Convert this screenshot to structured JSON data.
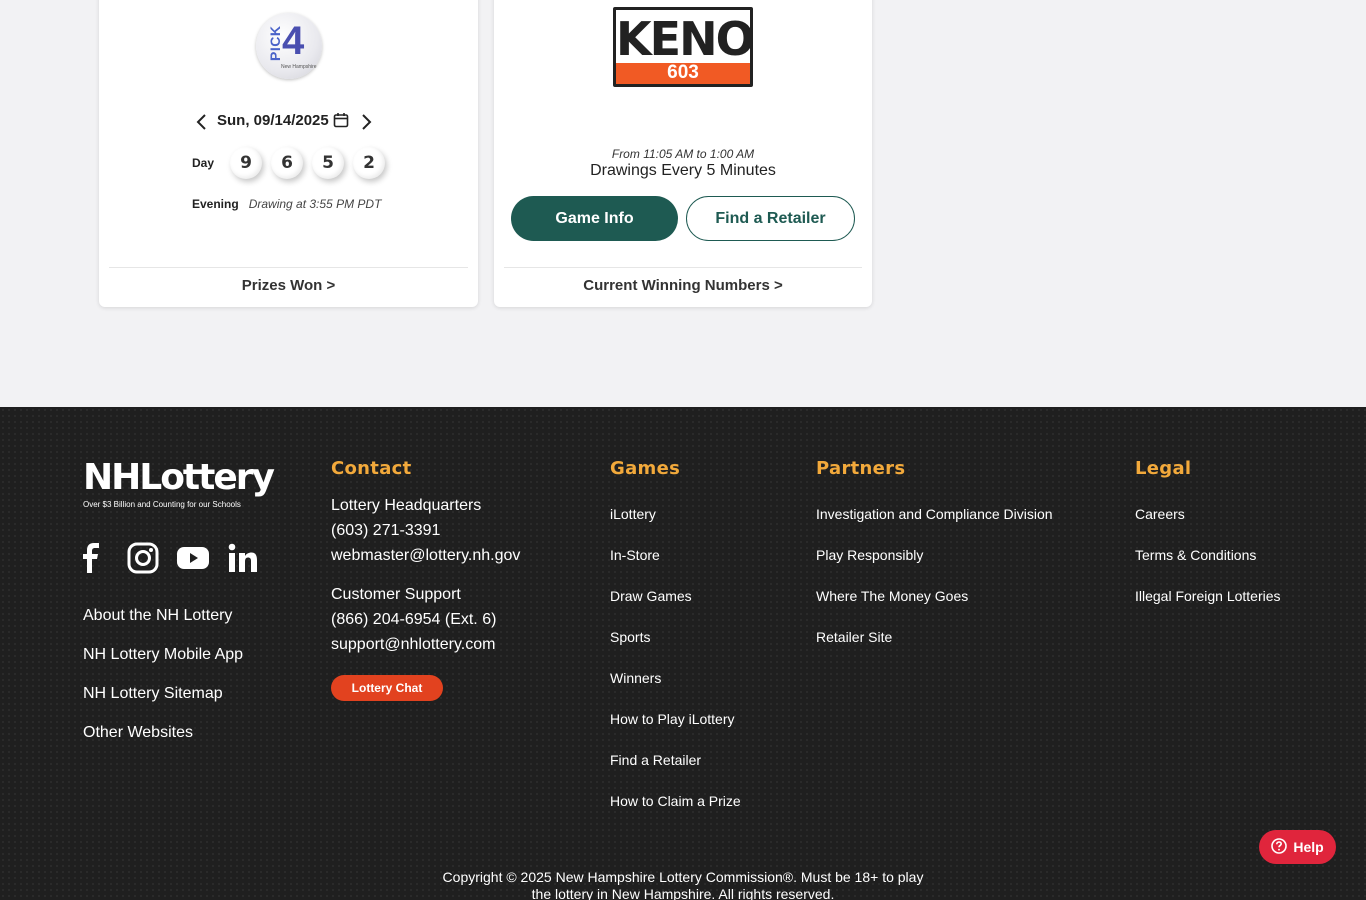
{
  "pick4": {
    "logo_text": "PICK",
    "logo_number": "4",
    "logo_sub": "New Hampshire",
    "date": "Sun, 09/14/2025",
    "day_label": "Day",
    "day_numbers": [
      "9",
      "6",
      "5",
      "2"
    ],
    "evening_label": "Evening",
    "evening_time": "Drawing at 3:55 PM PDT",
    "link": "Prizes Won >"
  },
  "keno": {
    "logo_word": "KENO",
    "logo_num": "603",
    "from": "From 11:05 AM to 1:00 AM",
    "every": "Drawings Every 5 Minutes",
    "game_info": "Game Info",
    "find_retailer": "Find a Retailer",
    "link": "Current Winning Numbers >"
  },
  "footer": {
    "logo_big": "NHLottery",
    "logo_small": "Over $3 Billion and Counting for our Schools",
    "about_links": [
      "About the NH Lottery",
      "NH Lottery Mobile App",
      "NH Lottery Sitemap",
      "Other Websites"
    ],
    "contact": {
      "heading": "Contact",
      "lines1": [
        "Lottery Headquarters",
        "(603) 271-3391",
        "webmaster@lottery.nh.gov"
      ],
      "lines2": [
        "Customer Support",
        "(866) 204-6954 (Ext. 6)",
        "support@nhlottery.com"
      ],
      "chat": "Lottery Chat"
    },
    "games": {
      "heading": "Games",
      "items": [
        "iLottery",
        "In-Store",
        "Draw Games",
        "Sports",
        "Winners",
        "How to Play iLottery",
        "Find a Retailer",
        "How to Claim a Prize"
      ]
    },
    "partners": {
      "heading": "Partners",
      "items": [
        "Investigation and Compliance Division",
        "Play Responsibly",
        "Where The Money Goes",
        "Retailer Site"
      ]
    },
    "legal": {
      "heading": "Legal",
      "items": [
        "Careers",
        "Terms & Conditions",
        "Illegal Foreign Lotteries"
      ]
    },
    "copyright1": "Copyright © 2025 New Hampshire Lottery Commission®. Must be 18+ to play",
    "copyright2": "the lottery in New Hampshire. All rights reserved."
  },
  "help": {
    "label": "Help"
  },
  "colors": {
    "accent_green": "#1e5a52",
    "footer_heading": "#f2a93b",
    "chat_red": "#e2421f",
    "help_red": "#e0253c"
  }
}
